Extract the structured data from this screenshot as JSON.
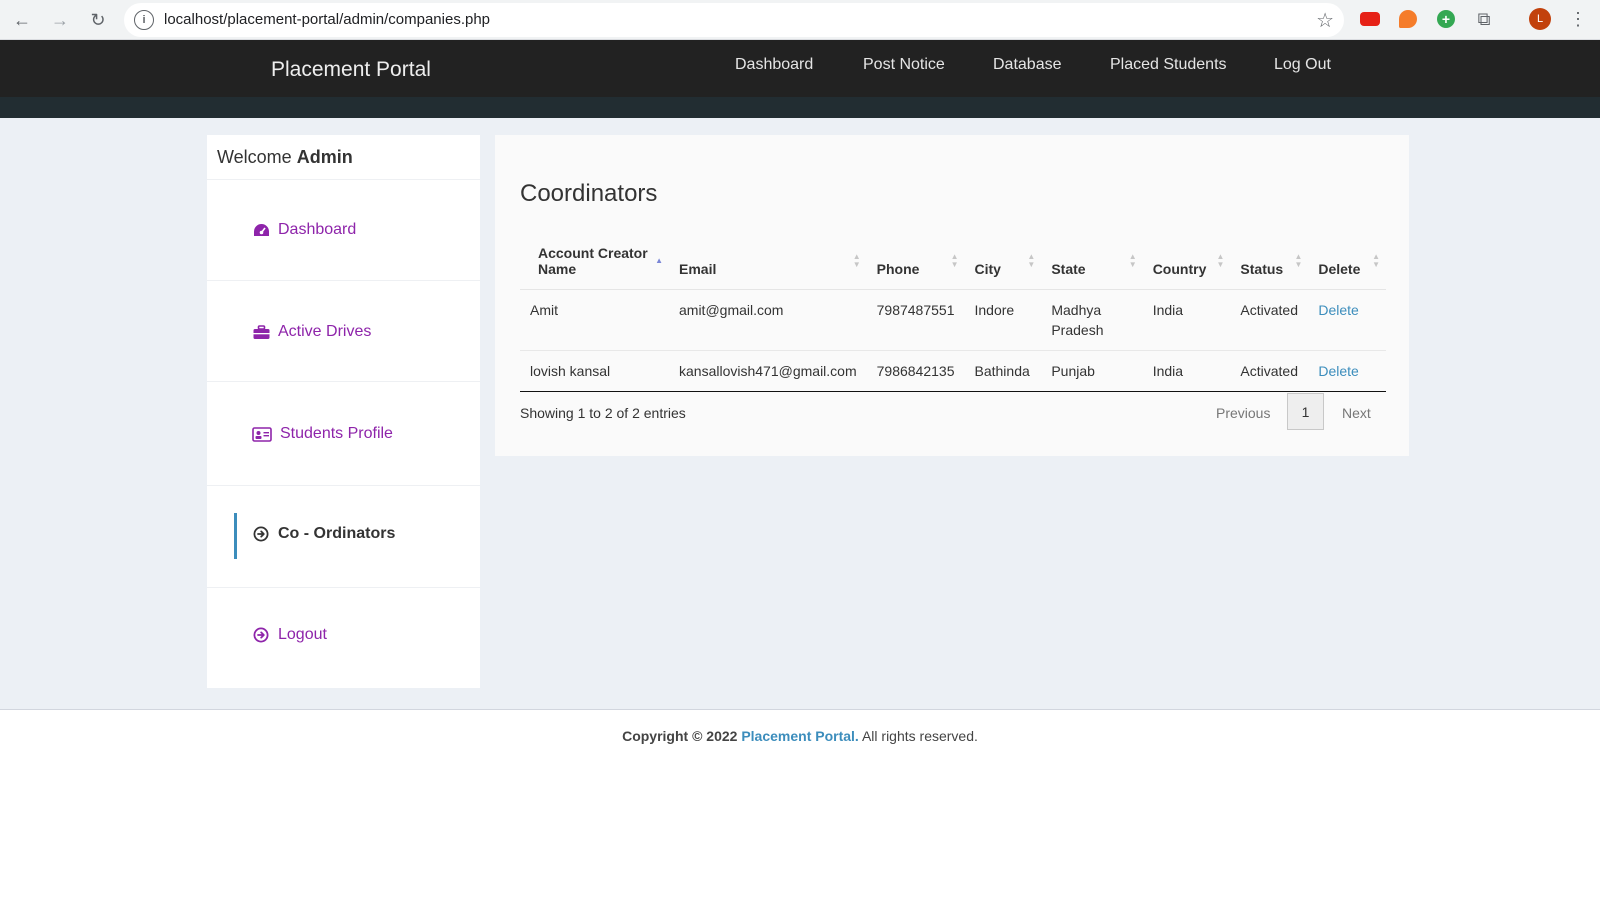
{
  "browser": {
    "url": "localhost/placement-portal/admin/companies.php",
    "profile_initial": "L"
  },
  "header": {
    "brand": "Placement Portal",
    "nav": [
      "Dashboard",
      "Post Notice",
      "Database",
      "Placed Students",
      "Log Out"
    ]
  },
  "sidebar": {
    "welcome_prefix": "Welcome",
    "welcome_user": "Admin",
    "items": [
      {
        "label": "Dashboard",
        "icon": "dashboard-icon"
      },
      {
        "label": "Active Drives",
        "icon": "briefcase-icon"
      },
      {
        "label": "Students Profile",
        "icon": "id-card-icon"
      },
      {
        "label": "Co - Ordinators",
        "icon": "arrow-circle-icon"
      },
      {
        "label": "Logout",
        "icon": "arrow-circle-icon"
      }
    ]
  },
  "main": {
    "title": "Coordinators",
    "table": {
      "headers": [
        "Account Creator Name",
        "Email",
        "Phone",
        "City",
        "State",
        "Country",
        "Status",
        "Delete"
      ],
      "rows": [
        {
          "name": "Amit",
          "email": "amit@gmail.com",
          "phone": "7987487551",
          "city": "Indore",
          "state": "Madhya Pradesh",
          "country": "India",
          "status": "Activated",
          "delete": "Delete"
        },
        {
          "name": "lovish kansal",
          "email": "kansallovish471@gmail.com",
          "phone": "7986842135",
          "city": "Bathinda",
          "state": "Punjab",
          "country": "India",
          "status": "Activated",
          "delete": "Delete"
        }
      ]
    },
    "info": "Showing 1 to 2 of 2 entries",
    "pagination": {
      "previous": "Previous",
      "page": "1",
      "next": "Next"
    }
  },
  "footer": {
    "prefix": "Copyright © 2022",
    "link": "Placement Portal.",
    "suffix": "All rights reserved."
  }
}
